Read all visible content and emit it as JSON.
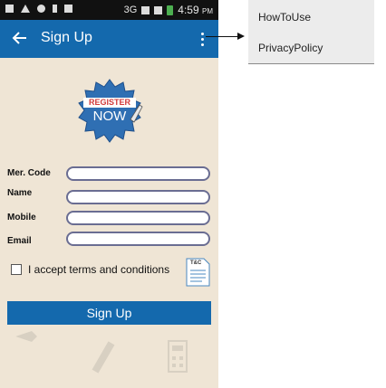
{
  "status_bar": {
    "network": "3G",
    "time": "4:59",
    "ampm": "PM"
  },
  "appbar": {
    "title": "Sign Up"
  },
  "badge": {
    "line1": "REGISTER",
    "line2": "NOW"
  },
  "form": {
    "fields": [
      {
        "label": "Mer. Code",
        "value": ""
      },
      {
        "label": "Name",
        "value": ""
      },
      {
        "label": "Mobile",
        "value": ""
      },
      {
        "label": "Email",
        "value": ""
      }
    ],
    "terms_label": "I accept terms and conditions",
    "terms_checked": false,
    "terms_doc_label": "T&C",
    "submit_label": "Sign Up"
  },
  "overflow_menu": {
    "items": [
      {
        "label": "HowToUse"
      },
      {
        "label": "PrivacyPolicy"
      }
    ]
  },
  "colors": {
    "primary": "#1469ad",
    "background": "#efe5d5",
    "field_border": "#6a6d92",
    "badge_blue": "#2f6fb3",
    "badge_red": "#d23a3a"
  }
}
